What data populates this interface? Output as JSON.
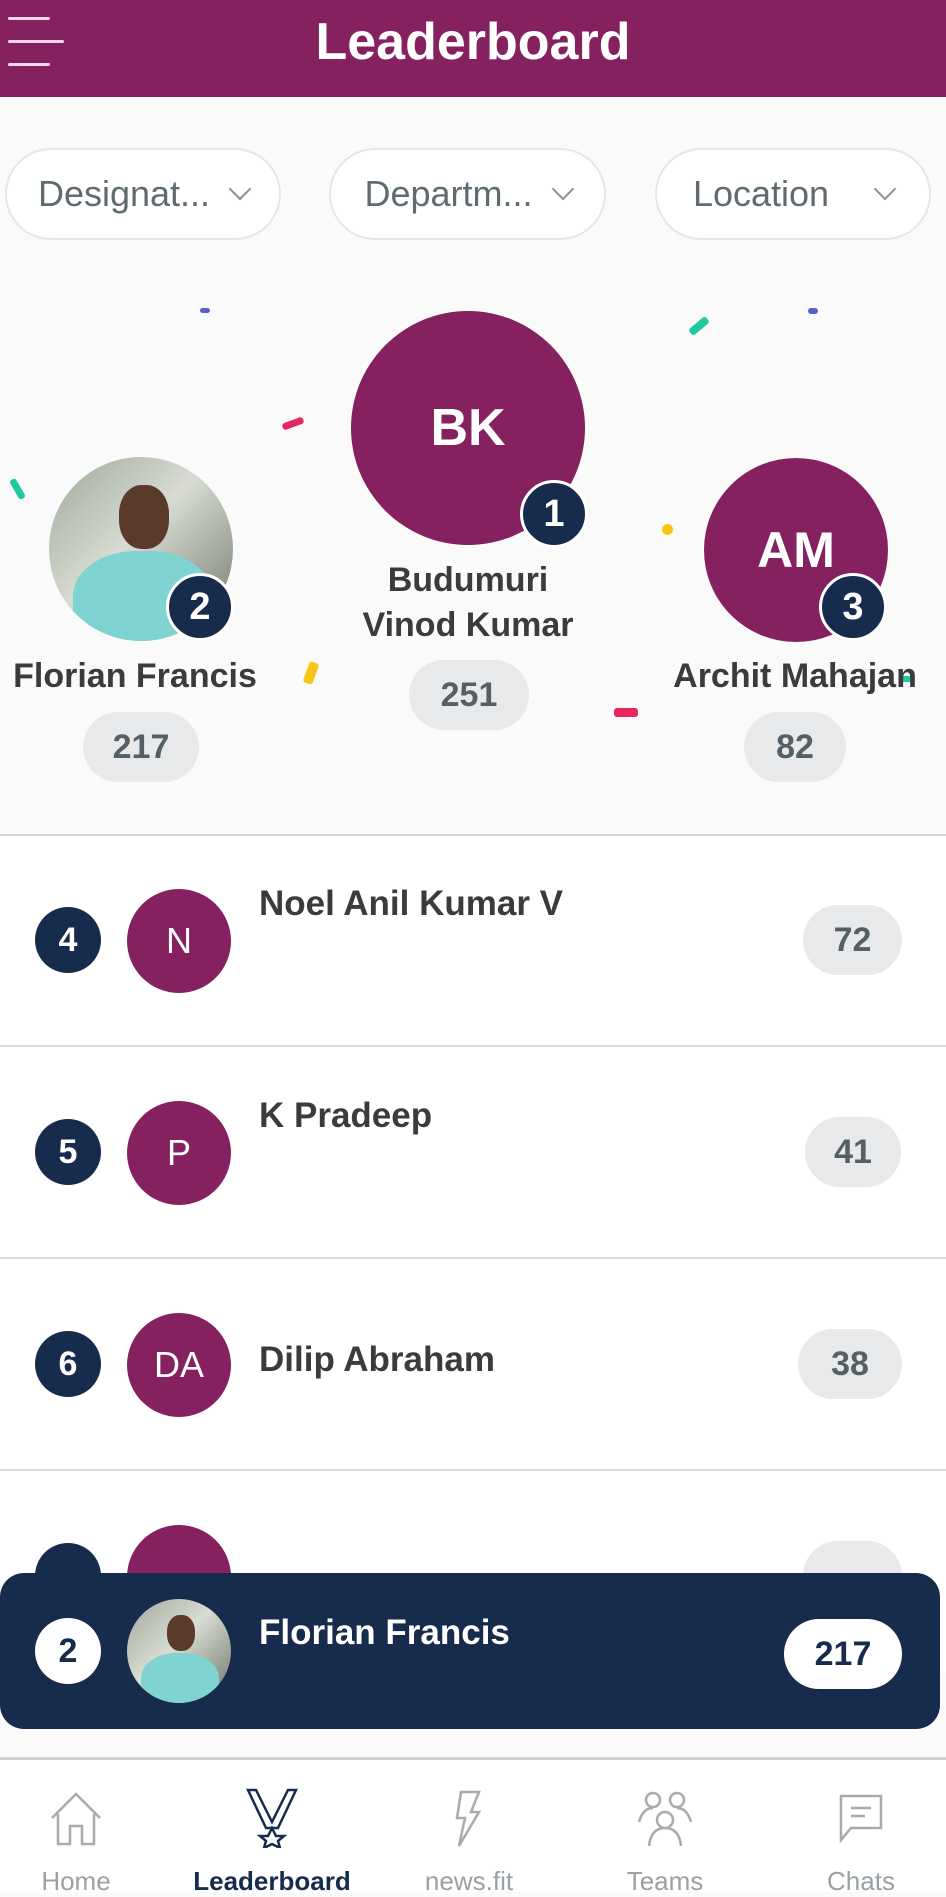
{
  "header": {
    "title": "Leaderboard",
    "menu_icon": "hamburger-menu-icon"
  },
  "filters": [
    {
      "label": "Designat..."
    },
    {
      "label": "Departm..."
    },
    {
      "label": "Location"
    }
  ],
  "podium": [
    {
      "rank": "1",
      "initials": "BK",
      "name_line1": "Budumuri",
      "name_line2": "Vinod Kumar",
      "score": "251"
    },
    {
      "rank": "2",
      "name": "Florian Francis",
      "score": "217",
      "avatar": "photo"
    },
    {
      "rank": "3",
      "initials": "AM",
      "name": "Archit Mahajan",
      "score": "82"
    }
  ],
  "list": [
    {
      "rank": "4",
      "initials": "N",
      "name": "Noel Anil Kumar V",
      "score": "72"
    },
    {
      "rank": "5",
      "initials": "P",
      "name": "K Pradeep",
      "score": "41"
    },
    {
      "rank": "6",
      "initials": "DA",
      "name": "Dilip Abraham",
      "score": "38"
    }
  ],
  "current_user": {
    "rank": "2",
    "name": "Florian Francis",
    "score": "217"
  },
  "nav": [
    {
      "label": "Home"
    },
    {
      "label": "Leaderboard",
      "active": true
    },
    {
      "label": "news.fit"
    },
    {
      "label": "Teams"
    },
    {
      "label": "Chats"
    }
  ],
  "colors": {
    "brand": "#84215e",
    "navy": "#172b4d"
  }
}
